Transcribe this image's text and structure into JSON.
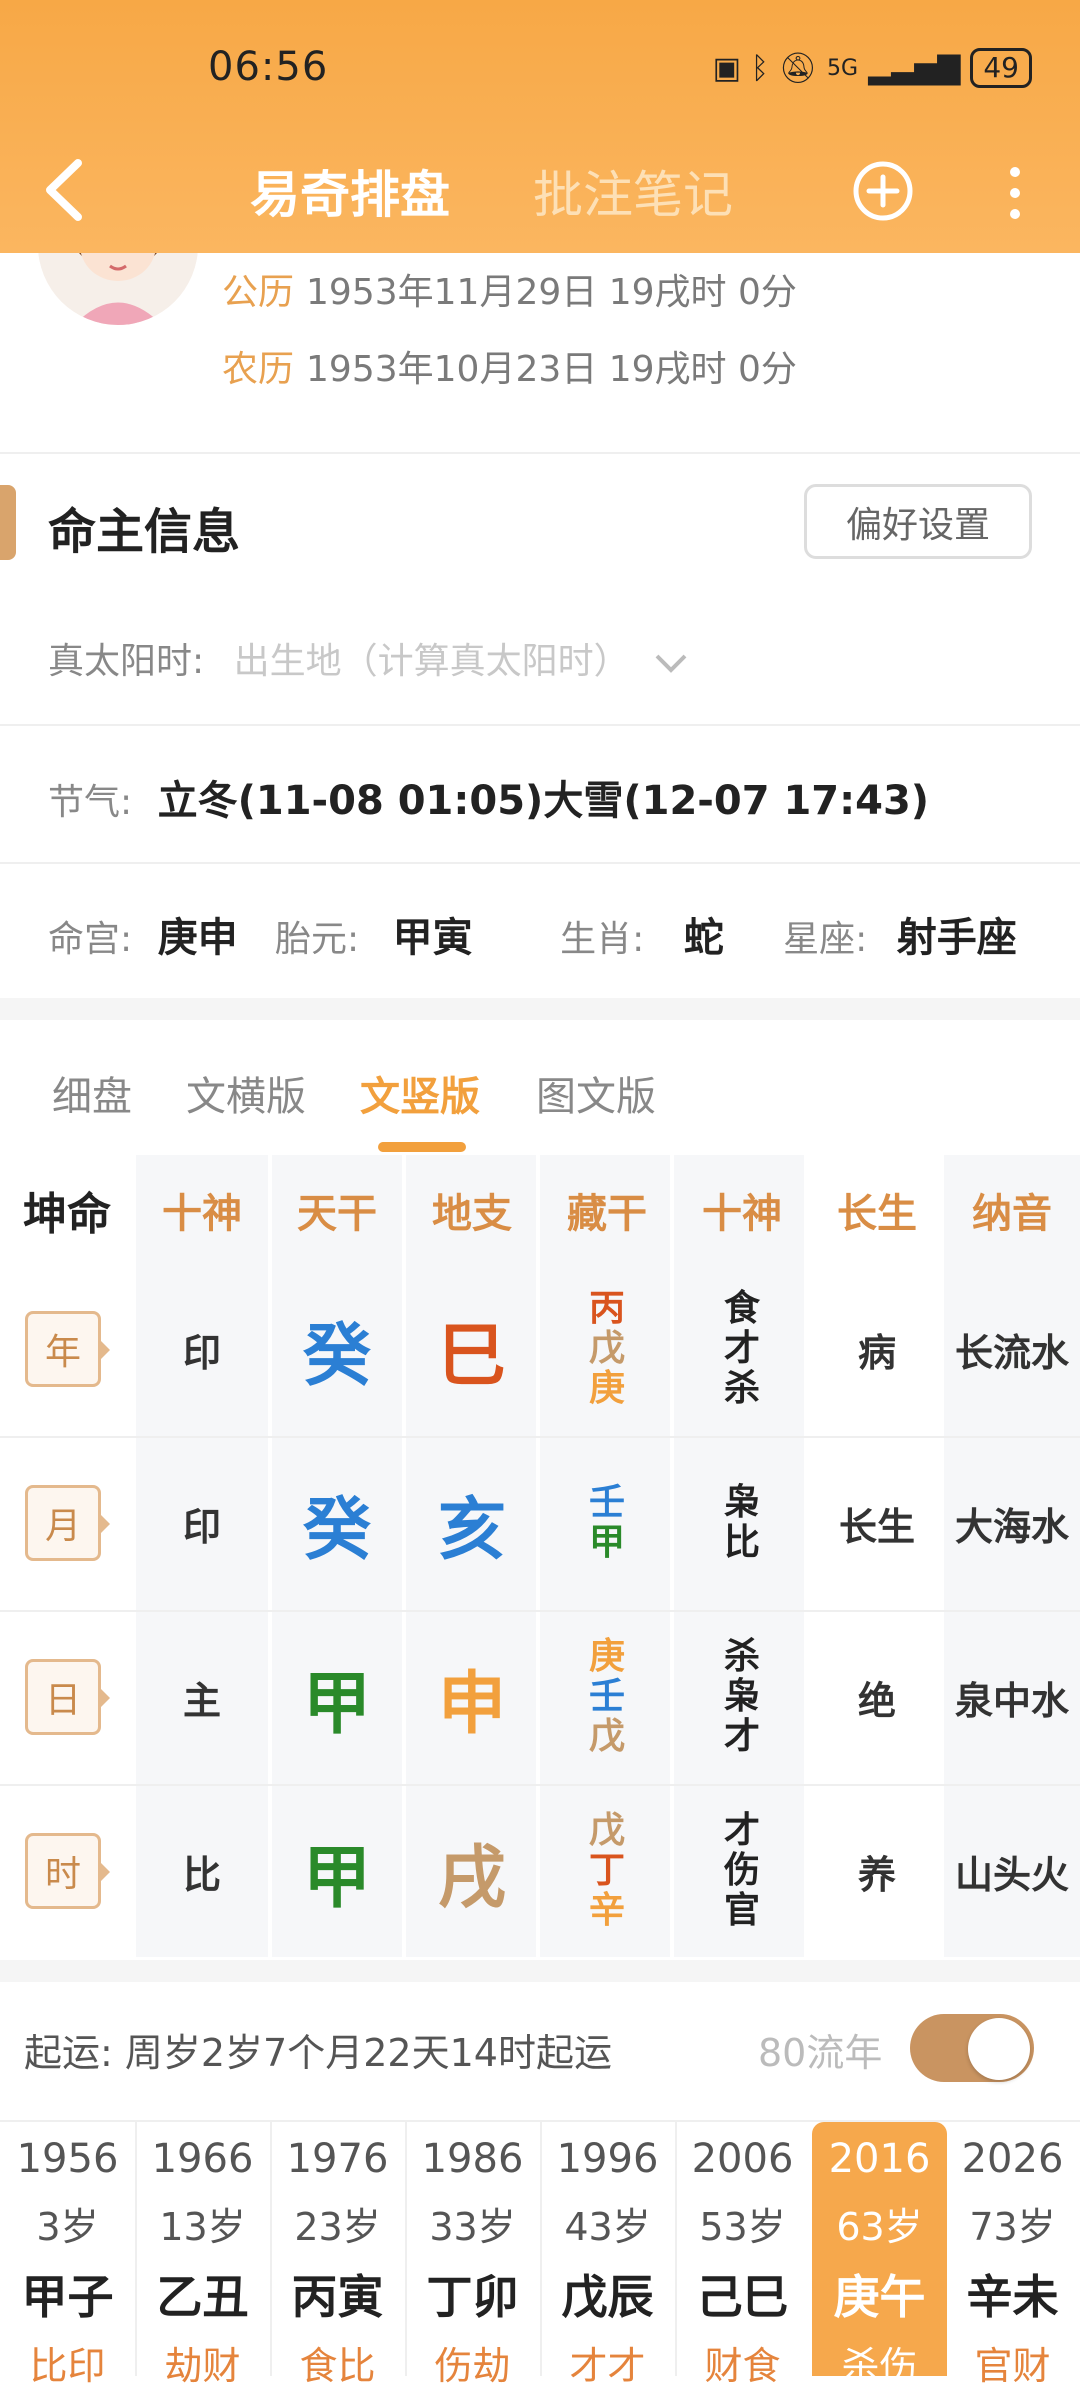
{
  "status": {
    "time": "06:56",
    "network": "5G",
    "battery": "49"
  },
  "header": {
    "tab_main": "易奇排盘",
    "tab_notes": "批注笔记"
  },
  "profile": {
    "solar_label": "公历",
    "solar_value": "1953年11月29日 19戌时 0分",
    "lunar_label": "农历",
    "lunar_value": "1953年10月23日 19戌时 0分"
  },
  "section": {
    "title": "命主信息",
    "pref_button": "偏好设置"
  },
  "info": {
    "true_solar_label": "真太阳时:",
    "true_solar_placeholder": "出生地（计算真太阳时）",
    "jieqi_label": "节气:",
    "jieqi_value": "立冬(11-08 01:05)大雪(12-07 17:43)",
    "minggong_label": "命宫:",
    "minggong_value": "庚申",
    "taiyuan_label": "胎元:",
    "taiyuan_value": "甲寅",
    "shengxiao_label": "生肖:",
    "shengxiao_value": "蛇",
    "xingzuo_label": "星座:",
    "xingzuo_value": "射手座"
  },
  "view_tabs": [
    "细盘",
    "文横版",
    "文竖版",
    "图文版"
  ],
  "table": {
    "title": "坤命",
    "headers": [
      "十神",
      "天干",
      "地支",
      "藏干",
      "十神",
      "长生",
      "纳音"
    ],
    "rows": [
      {
        "label": "年",
        "shishen": "印",
        "tiangan": "癸",
        "dizhi": "巳",
        "canggan": [
          "丙",
          "戊",
          "庚"
        ],
        "canggan_shishen": [
          "食",
          "才",
          "杀"
        ],
        "changsheng": "病",
        "nayin": "长流水"
      },
      {
        "label": "月",
        "shishen": "印",
        "tiangan": "癸",
        "dizhi": "亥",
        "canggan": [
          "壬",
          "甲"
        ],
        "canggan_shishen": [
          "枭",
          "比"
        ],
        "changsheng": "长生",
        "nayin": "大海水"
      },
      {
        "label": "日",
        "shishen": "主",
        "tiangan": "甲",
        "dizhi": "申",
        "canggan": [
          "庚",
          "壬",
          "戊"
        ],
        "canggan_shishen": [
          "杀",
          "枭",
          "才"
        ],
        "changsheng": "绝",
        "nayin": "泉中水"
      },
      {
        "label": "时",
        "shishen": "比",
        "tiangan": "甲",
        "dizhi": "戌",
        "canggan": [
          "戊",
          "丁",
          "辛"
        ],
        "canggan_shishen": [
          "才",
          "伤",
          "官"
        ],
        "changsheng": "养",
        "nayin": "山头火"
      }
    ]
  },
  "colors": {
    "water": "#2b7fd4",
    "wood": "#2a8a2a",
    "fire": "#d9541e",
    "earth": "#c59a6a",
    "metal": "#f2a03d",
    "accent": "#f2a03d"
  },
  "qiyun": {
    "text": "起运:  周岁2岁7个月22天14时起运",
    "liunian": "80流年"
  },
  "dayun": [
    {
      "year": "1956",
      "age": "3岁",
      "ganzhi": "甲子",
      "sub": "比印"
    },
    {
      "year": "1966",
      "age": "13岁",
      "ganzhi": "乙丑",
      "sub": "劫财"
    },
    {
      "year": "1976",
      "age": "23岁",
      "ganzhi": "丙寅",
      "sub": "食比"
    },
    {
      "year": "1986",
      "age": "33岁",
      "ganzhi": "丁卯",
      "sub": "伤劫"
    },
    {
      "year": "1996",
      "age": "43岁",
      "ganzhi": "戊辰",
      "sub": "才才"
    },
    {
      "year": "2006",
      "age": "53岁",
      "ganzhi": "己巳",
      "sub": "财食"
    },
    {
      "year": "2016",
      "age": "63岁",
      "ganzhi": "庚午",
      "sub": "杀伤"
    },
    {
      "year": "2026",
      "age": "73岁",
      "ganzhi": "辛未",
      "sub": "官财"
    }
  ]
}
